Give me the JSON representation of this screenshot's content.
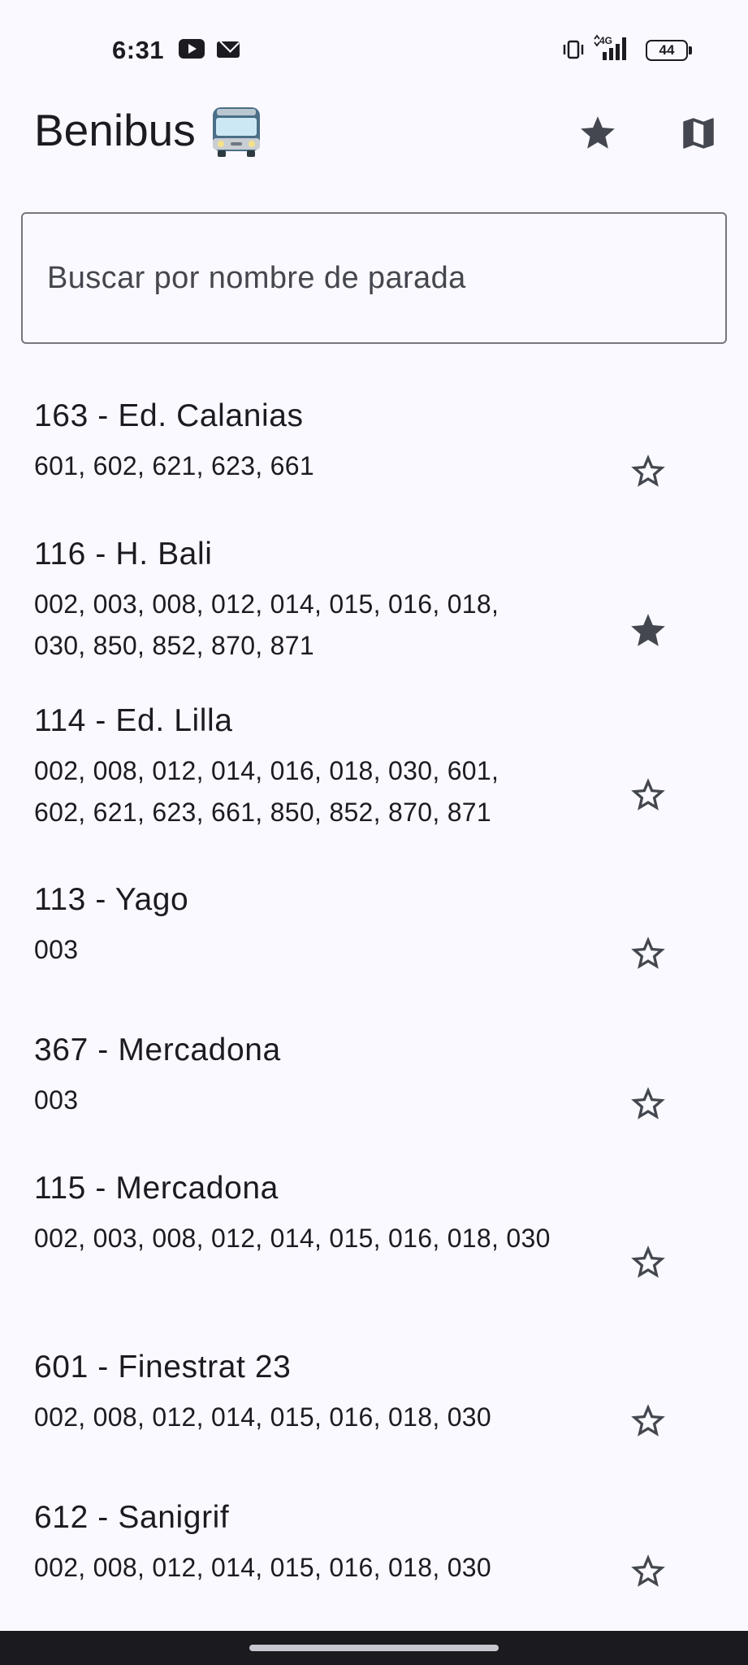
{
  "status_bar": {
    "time": "6:31",
    "network": "4G",
    "battery": "44"
  },
  "app": {
    "title": "Benibus",
    "title_icon": "bus-emoji",
    "favorites_icon": "star-filled-icon",
    "map_icon": "map-icon"
  },
  "search": {
    "placeholder": "Buscar por nombre de parada",
    "value": ""
  },
  "colors": {
    "background": "#f9f9ff",
    "text": "#1b1b21",
    "icon": "#44474f",
    "outline": "#767680"
  },
  "stops": [
    {
      "name": "163 - Ed. Calanias",
      "lines": "601, 602, 621, 623, 661",
      "favorite": false
    },
    {
      "name": "116 - H. Bali",
      "lines": "002, 003, 008, 012, 014, 015, 016, 018, 030, 850, 852, 870, 871",
      "favorite": true
    },
    {
      "name": "114 - Ed. Lilla",
      "lines": "002, 008, 012, 014, 016, 018, 030, 601, 602, 621, 623, 661, 850, 852, 870, 871",
      "favorite": false
    },
    {
      "name": "113 - Yago",
      "lines": "003",
      "favorite": false
    },
    {
      "name": "367 - Mercadona",
      "lines": "003",
      "favorite": false
    },
    {
      "name": "115 - Mercadona",
      "lines": "002, 003, 008, 012, 014, 015, 016, 018, 030",
      "favorite": false
    },
    {
      "name": "601 - Finestrat 23",
      "lines": "002, 008, 012, 014, 015, 016, 018, 030",
      "favorite": false
    },
    {
      "name": "612 - Sanigrif",
      "lines": "002, 008, 012, 014, 015, 016, 018, 030",
      "favorite": false
    }
  ]
}
